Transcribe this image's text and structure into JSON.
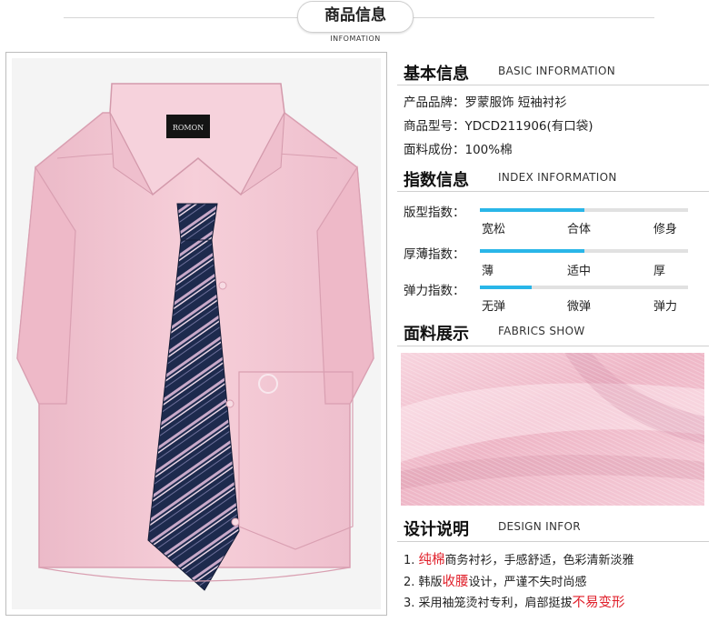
{
  "header": {
    "title": "商品信息",
    "subtitle": "INFOMATION"
  },
  "product_image": {
    "alt": "粉色短袖衬衫配深蓝斜纹领带",
    "collar_label": "ROMON",
    "shirt_color": "#f2c6d3",
    "tie_color": "#1d2a4d"
  },
  "basic": {
    "title": "基本信息",
    "subtitle": "BASIC INFORMATION",
    "brand": "产品品牌：罗蒙服饰 短袖衬衫",
    "model": "商品型号：YDCD211906(有口袋)",
    "fabric": "面料成份：100%棉"
  },
  "index": {
    "title": "指数信息",
    "subtitle": "INDEX INFORMATION",
    "accent_color": "#29b6e8",
    "rows": [
      {
        "label": "版型指数：",
        "level": 0.5,
        "ticks": [
          "宽松",
          "合体",
          "修身"
        ]
      },
      {
        "label": "厚薄指数：",
        "level": 0.5,
        "ticks": [
          "薄",
          "适中",
          "厚"
        ]
      },
      {
        "label": "弹力指数：",
        "level": 0.25,
        "ticks": [
          "无弹",
          "微弹",
          "弹力"
        ]
      }
    ]
  },
  "fabrics": {
    "title": "面料展示",
    "subtitle": "FABRICS SHOW",
    "swatch_color": "#f3c4d3"
  },
  "design": {
    "title": "设计说明",
    "subtitle": "DESIGN INFOR",
    "highlight_color": "#e0202b",
    "items": [
      {
        "prefix": "1. ",
        "highlight": "纯棉",
        "rest": "商务衬衫，手感舒适，色彩清新淡雅"
      },
      {
        "prefix": "2. 韩版",
        "highlight": "收腰",
        "rest": "设计，严谨不失时尚感"
      },
      {
        "prefix": "3. 采用袖笼烫衬专利，肩部挺拔",
        "highlight": "不易变形",
        "rest": ""
      }
    ]
  }
}
